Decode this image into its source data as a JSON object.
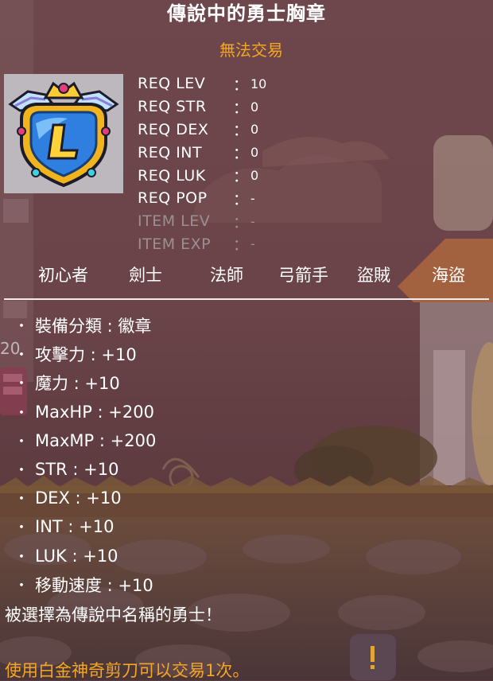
{
  "item": {
    "name": "傳說中的勇士胸章",
    "trade_status": "無法交易"
  },
  "icon": {
    "name": "legend-medal-icon"
  },
  "requirements": [
    {
      "label": "REQ LEV",
      "sep": "：",
      "value": "10",
      "dim": false
    },
    {
      "label": "REQ STR",
      "sep": "：",
      "value": "0",
      "dim": false
    },
    {
      "label": "REQ DEX",
      "sep": "：",
      "value": "0",
      "dim": false
    },
    {
      "label": "REQ INT",
      "sep": "：",
      "value": "0",
      "dim": false
    },
    {
      "label": "REQ LUK",
      "sep": "：",
      "value": "0",
      "dim": false
    },
    {
      "label": "REQ POP",
      "sep": "：",
      "value": "-",
      "dim": false
    },
    {
      "label": "ITEM LEV",
      "sep": "：",
      "value": "-",
      "dim": true
    },
    {
      "label": "ITEM EXP",
      "sep": "：",
      "value": "-",
      "dim": true
    }
  ],
  "jobs": [
    "初心者",
    "劍士",
    "法師",
    "弓箭手",
    "盜賊",
    "海盜"
  ],
  "stats": [
    "裝備分類 : 徽章",
    "攻擊力 : +10",
    "魔力 : +10",
    "MaxHP : +200",
    "MaxMP : +200",
    "STR : +10",
    "DEX : +10",
    "INT : +10",
    "LUK : +10",
    "移動速度 : +10"
  ],
  "bullet": "・",
  "description": "被選擇為傳說中名稱的勇士！",
  "notice": "使用白金神奇剪刀可以交易1次。",
  "background_label": "20",
  "colors": {
    "accent_orange": "#f5a623",
    "text_white": "#ffffff",
    "text_dim": "#9c8f92",
    "icon_bg": "#bcb8bd"
  }
}
